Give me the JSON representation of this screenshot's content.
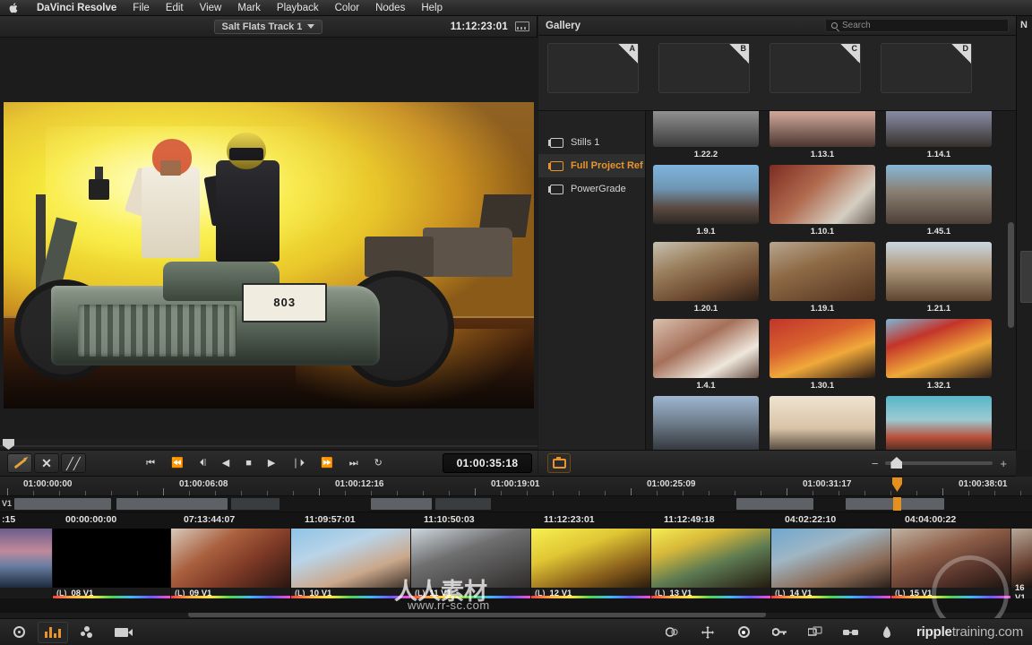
{
  "menubar": {
    "apple_icon": "apple-logo",
    "items": [
      {
        "label": "DaVinci Resolve",
        "bold": true
      },
      {
        "label": "File",
        "bold": false
      },
      {
        "label": "Edit",
        "bold": false
      },
      {
        "label": "View",
        "bold": false
      },
      {
        "label": "Mark",
        "bold": false
      },
      {
        "label": "Playback",
        "bold": false
      },
      {
        "label": "Color",
        "bold": false
      },
      {
        "label": "Nodes",
        "bold": false
      },
      {
        "label": "Help",
        "bold": false
      }
    ]
  },
  "viewer": {
    "title": "Salt Flats Track 1",
    "timecode": "11:12:23:01",
    "display_icon": "filmstrip-icon",
    "plate_number": "803"
  },
  "transport": {
    "tools": [
      {
        "name": "pencil-tool",
        "selected": true
      },
      {
        "name": "shuffle-tool",
        "selected": false
      },
      {
        "name": "bypass-tool",
        "selected": false
      }
    ],
    "buttons": [
      {
        "name": "jump-to-start",
        "glyph": "⏮"
      },
      {
        "name": "rewind",
        "glyph": "⏪"
      },
      {
        "name": "previous-clip",
        "glyph": "⏴❘"
      },
      {
        "name": "step-back",
        "glyph": "◀"
      },
      {
        "name": "stop",
        "glyph": "■"
      },
      {
        "name": "play",
        "glyph": "▶"
      },
      {
        "name": "step-forward",
        "glyph": "❘⏵"
      },
      {
        "name": "fast-forward",
        "glyph": "⏩"
      },
      {
        "name": "next-clip",
        "glyph": "⏭"
      },
      {
        "name": "loop",
        "glyph": "↻"
      }
    ],
    "timecode": "01:00:35:18"
  },
  "gallery": {
    "title": "Gallery",
    "search_placeholder": "Search",
    "search_icon": "search-icon",
    "memory_slots": [
      "A",
      "B",
      "C",
      "D"
    ],
    "albums": [
      {
        "label": "Stills 1",
        "active": false
      },
      {
        "label": "Full Project Ref",
        "active": true
      },
      {
        "label": "PowerGrade",
        "active": false
      }
    ],
    "add_label": "+",
    "remove_label": "−",
    "stills": [
      {
        "label": "1.22.2"
      },
      {
        "label": "1.13.1"
      },
      {
        "label": "1.14.1"
      },
      {
        "label": "1.9.1"
      },
      {
        "label": "1.10.1"
      },
      {
        "label": "1.45.1"
      },
      {
        "label": "1.20.1"
      },
      {
        "label": "1.19.1"
      },
      {
        "label": "1.21.1"
      },
      {
        "label": "1.4.1"
      },
      {
        "label": "1.30.1"
      },
      {
        "label": "1.32.1"
      },
      {
        "label": ""
      },
      {
        "label": ""
      },
      {
        "label": ""
      }
    ],
    "bottom": {
      "camera_icon": "gallery-camera-icon",
      "zoom_minus": "−",
      "zoom_plus": "+"
    }
  },
  "right_panel": {
    "label": "N"
  },
  "timeline": {
    "ruler_timecodes": [
      "01:00:00:00",
      "01:00:06:08",
      "01:00:12:16",
      "01:00:19:01",
      "01:00:25:09",
      "01:00:31:17",
      "01:00:38:01"
    ],
    "track_label": "V1",
    "clip_timecodes": [
      ":15",
      "00:00:00:00",
      "07:13:44:07",
      "11:09:57:01",
      "11:10:50:03",
      "11:12:23:01",
      "11:12:49:18",
      "04:02:22:10",
      "04:04:00:22"
    ],
    "clips": [
      {
        "name": "",
        "lock": "",
        "selected": false
      },
      {
        "name": "08 V1",
        "lock": "(L)",
        "selected": false
      },
      {
        "name": "09 V1",
        "lock": "(L)",
        "selected": false
      },
      {
        "name": "10 V1",
        "lock": "(L)",
        "selected": false
      },
      {
        "name": "11 V1",
        "lock": "(L)",
        "selected": false
      },
      {
        "name": "12 V1",
        "lock": "(L)",
        "selected": false
      },
      {
        "name": "13 V1",
        "lock": "(L)",
        "selected": true
      },
      {
        "name": "14 V1",
        "lock": "(L)",
        "selected": false
      },
      {
        "name": "15 V1",
        "lock": "(L)",
        "selected": false
      },
      {
        "name": "16 V1",
        "lock": "(L)",
        "selected": false
      }
    ]
  },
  "bottombar": {
    "left_icons": [
      {
        "name": "color-wheels-icon",
        "active": false
      },
      {
        "name": "curves-bars-icon",
        "active": true
      },
      {
        "name": "tracker-icon",
        "active": false
      },
      {
        "name": "clip-icon",
        "active": false
      }
    ],
    "right_icons": [
      {
        "name": "blur-icon"
      },
      {
        "name": "sizing-icon"
      },
      {
        "name": "scopes-icon"
      },
      {
        "name": "key-icon"
      },
      {
        "name": "stereo-icon"
      },
      {
        "name": "glasses-icon"
      },
      {
        "name": "data-burn-icon"
      }
    ],
    "watermark_bold": "ripple",
    "watermark_rest": "training.com"
  },
  "overlay_watermark": {
    "logo": "人人素材",
    "url": "www.rr-sc.com"
  },
  "colors": {
    "accent": "#e9952c",
    "panel": "#1d1d1d",
    "bar": "#2a2a2a",
    "text": "#dcdcdc"
  }
}
